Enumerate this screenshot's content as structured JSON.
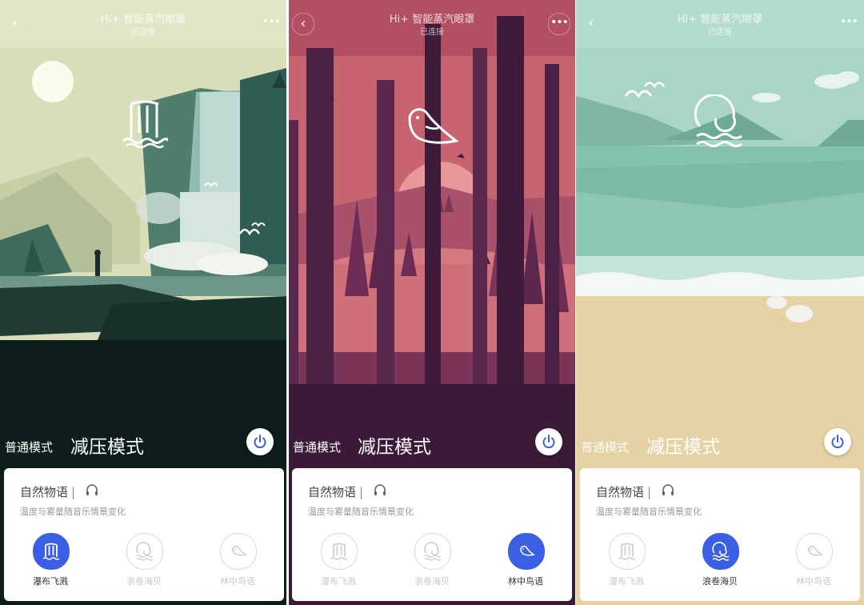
{
  "screens": [
    {
      "app_title": "Hi+ 智能蒸汽眼罩",
      "status": "已连接",
      "mode_normal": "普通模式",
      "mode_relax": "减压模式",
      "card": {
        "title": "自然物语",
        "separator": "|",
        "description": "温度与雾量随音乐情景变化",
        "options": [
          {
            "label": "瀑布飞溅",
            "icon": "waterfall-icon",
            "active": true
          },
          {
            "label": "浪卷海贝",
            "icon": "wave-icon",
            "active": false
          },
          {
            "label": "林中鸟语",
            "icon": "bird-icon",
            "active": false
          }
        ]
      }
    },
    {
      "app_title": "Hi+ 智能蒸汽眼罩",
      "status": "已连接",
      "mode_normal": "普通模式",
      "mode_relax": "减压模式",
      "card": {
        "title": "自然物语",
        "separator": "|",
        "description": "温度与雾量随音乐情景变化",
        "options": [
          {
            "label": "瀑布飞溅",
            "icon": "waterfall-icon",
            "active": false
          },
          {
            "label": "浪卷海贝",
            "icon": "wave-icon",
            "active": false
          },
          {
            "label": "林中鸟语",
            "icon": "bird-icon",
            "active": true
          }
        ]
      }
    },
    {
      "app_title": "Hi+ 智能蒸汽眼罩",
      "status": "已连接",
      "mode_normal": "普通模式",
      "mode_relax": "减压模式",
      "card": {
        "title": "自然物语",
        "separator": "|",
        "description": "温度与雾量随音乐情景变化",
        "options": [
          {
            "label": "瀑布飞溅",
            "icon": "waterfall-icon",
            "active": false
          },
          {
            "label": "浪卷海贝",
            "icon": "wave-icon",
            "active": true
          },
          {
            "label": "林中鸟语",
            "icon": "bird-icon",
            "active": false
          }
        ]
      }
    }
  ],
  "colors": {
    "accent": "#3a5fe5",
    "inactive_label": "#c8c8c8",
    "waterfall_bg": "#0d1d1c",
    "forest_bg": "#3a1a37",
    "beach_bg": "#e5d3a5"
  }
}
